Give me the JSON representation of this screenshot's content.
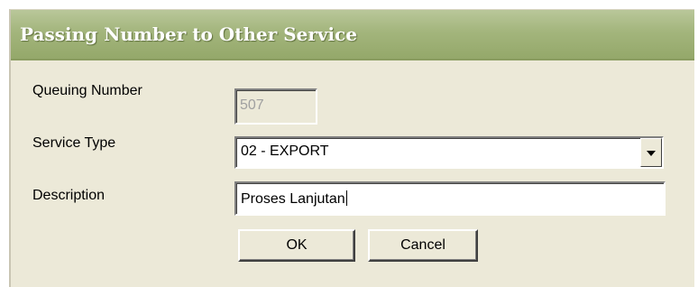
{
  "dialog": {
    "title": "Passing Number to Other Service"
  },
  "form": {
    "queuing_number_label": "Queuing Number",
    "queuing_number_value": "507",
    "service_type_label": "Service Type",
    "service_type_value": "02 - EXPORT",
    "description_label": "Description",
    "description_value": "Proses Lanjutan"
  },
  "buttons": {
    "ok_label": "OK",
    "cancel_label": "Cancel"
  },
  "colors": {
    "titlebar": "#a3b57c",
    "title_text": "#ffffff",
    "dialog_background": "#ece9d8",
    "disabled_text": "#a0a0a0"
  },
  "icons": {
    "dropdown": "chevron-down-icon"
  }
}
